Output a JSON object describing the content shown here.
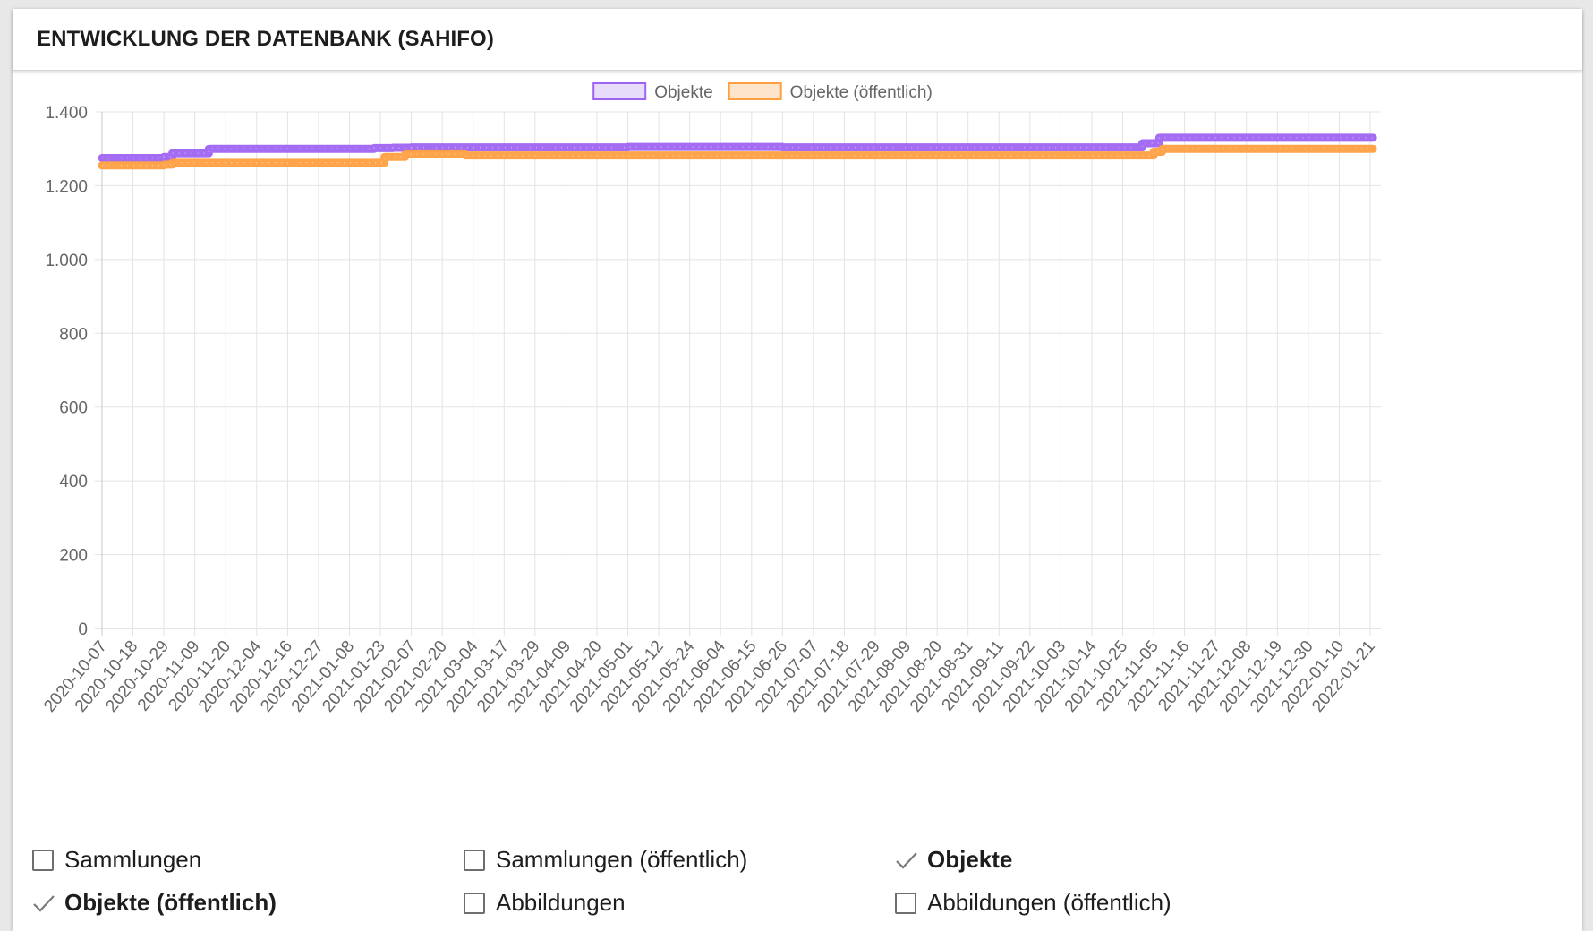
{
  "title": "ENTWICKLUNG DER DATENBANK (SAHIFO)",
  "colors": {
    "objekte": "#9f63f2",
    "objekte_fill": "#e8dcfb",
    "oeffentlich": "#ff9f40",
    "oeffentlich_fill": "#ffe4cc",
    "grid": "#e3e3e3",
    "tick": "#666666"
  },
  "chart_data": {
    "type": "line",
    "x_tick_labels": [
      "2020-10-07",
      "2020-10-18",
      "2020-10-29",
      "2020-11-09",
      "2020-11-20",
      "2020-12-04",
      "2020-12-16",
      "2020-12-27",
      "2021-01-08",
      "2021-01-23",
      "2021-02-07",
      "2021-02-20",
      "2021-03-04",
      "2021-03-17",
      "2021-03-29",
      "2021-04-09",
      "2021-04-20",
      "2021-05-01",
      "2021-05-12",
      "2021-05-24",
      "2021-06-04",
      "2021-06-15",
      "2021-06-26",
      "2021-07-07",
      "2021-07-18",
      "2021-07-29",
      "2021-08-09",
      "2021-08-20",
      "2021-08-31",
      "2021-09-11",
      "2021-09-22",
      "2021-10-03",
      "2021-10-14",
      "2021-10-25",
      "2021-11-05",
      "2021-11-16",
      "2021-11-27",
      "2021-12-08",
      "2021-12-19",
      "2021-12-30",
      "2022-01-10",
      "2022-01-21"
    ],
    "y_ticks": [
      "0",
      "200",
      "400",
      "600",
      "800",
      "1.000",
      "1.200",
      "1.400"
    ],
    "ylim": [
      0,
      1400
    ],
    "grid": true,
    "legend_position": "top-center",
    "series": [
      {
        "name": "Objekte",
        "color": "#9f63f2",
        "steps": [
          {
            "from": "2020-10-07",
            "value": 1275
          },
          {
            "from": "2020-10-29",
            "value": 1278
          },
          {
            "from": "2020-11-01",
            "value": 1288
          },
          {
            "from": "2020-11-14",
            "value": 1300
          },
          {
            "from": "2021-01-20",
            "value": 1302
          },
          {
            "from": "2021-01-29",
            "value": 1303
          },
          {
            "from": "2021-02-07",
            "value": 1304
          },
          {
            "from": "2021-05-01",
            "value": 1305
          },
          {
            "from": "2021-06-26",
            "value": 1304
          },
          {
            "from": "2021-11-01",
            "value": 1315
          },
          {
            "from": "2021-11-07",
            "value": 1330
          },
          {
            "from": "2022-01-22",
            "value": 1330
          }
        ]
      },
      {
        "name": "Objekte (öffentlich)",
        "color": "#ff9f40",
        "steps": [
          {
            "from": "2020-10-07",
            "value": 1255
          },
          {
            "from": "2020-10-29",
            "value": 1257
          },
          {
            "from": "2020-11-01",
            "value": 1262
          },
          {
            "from": "2021-01-25",
            "value": 1278
          },
          {
            "from": "2021-02-04",
            "value": 1285
          },
          {
            "from": "2021-03-01",
            "value": 1282
          },
          {
            "from": "2021-11-05",
            "value": 1292
          },
          {
            "from": "2021-11-08",
            "value": 1300
          },
          {
            "from": "2022-01-22",
            "value": 1300
          }
        ]
      }
    ]
  },
  "options": [
    {
      "label": "Sammlungen",
      "checked": false
    },
    {
      "label": "Sammlungen (öffentlich)",
      "checked": false
    },
    {
      "label": "Objekte",
      "checked": true
    },
    {
      "label": "Objekte (öffentlich)",
      "checked": true
    },
    {
      "label": "Abbildungen",
      "checked": false
    },
    {
      "label": "Abbildungen (öffentlich)",
      "checked": false
    }
  ]
}
